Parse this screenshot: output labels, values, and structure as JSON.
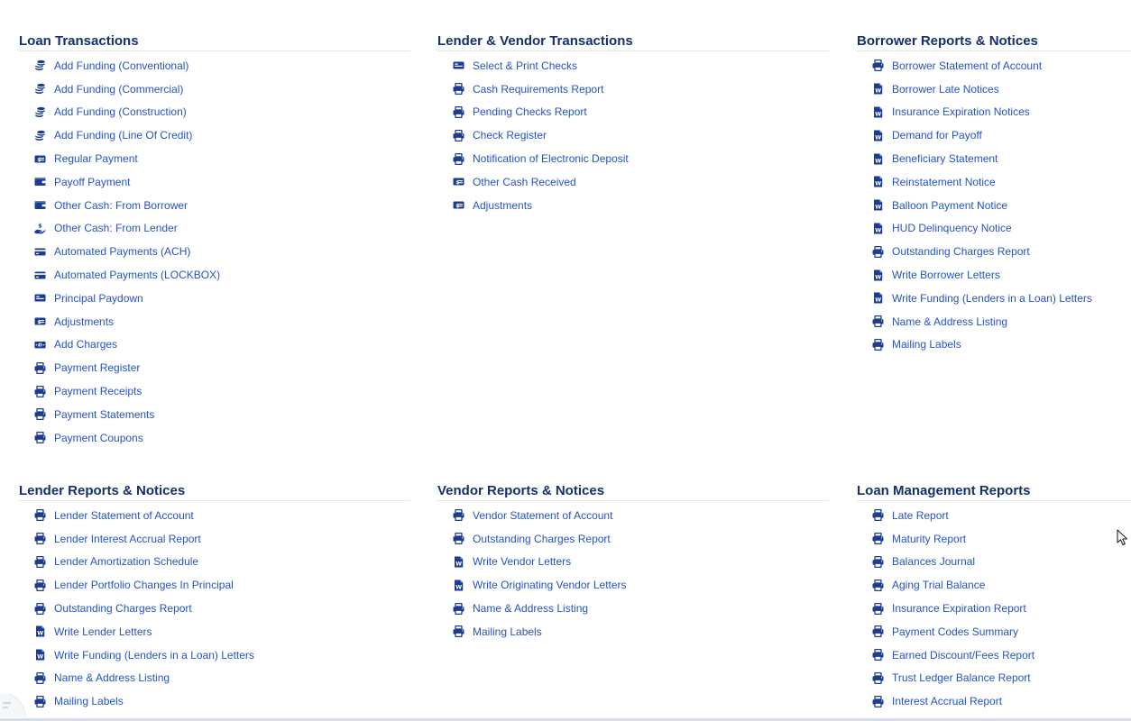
{
  "colors": {
    "heading": "#14306e",
    "link": "#2453c6",
    "icon": "#1c3c94",
    "divider": "#e2e5ea"
  },
  "sections": [
    {
      "title": "Loan Transactions",
      "items": [
        {
          "label": "Add Funding (Conventional)",
          "icon": "coins-icon"
        },
        {
          "label": "Add Funding (Commercial)",
          "icon": "coins-icon"
        },
        {
          "label": "Add Funding (Construction)",
          "icon": "coins-icon"
        },
        {
          "label": "Add Funding (Line Of Credit)",
          "icon": "coins-icon"
        },
        {
          "label": "Regular Payment",
          "icon": "money-card-icon"
        },
        {
          "label": "Payoff Payment",
          "icon": "wallet-icon"
        },
        {
          "label": "Other Cash: From Borrower",
          "icon": "wallet-icon"
        },
        {
          "label": "Other Cash: From Lender",
          "icon": "hand-dollar-icon"
        },
        {
          "label": "Automated Payments (ACH)",
          "icon": "credit-card-icon"
        },
        {
          "label": "Automated Payments (LOCKBOX)",
          "icon": "credit-card-icon"
        },
        {
          "label": "Principal Paydown",
          "icon": "id-card-icon"
        },
        {
          "label": "Adjustments",
          "icon": "money-card-icon"
        },
        {
          "label": "Add Charges",
          "icon": "money-bill-icon"
        },
        {
          "label": "Payment Register",
          "icon": "printer-icon"
        },
        {
          "label": "Payment Receipts",
          "icon": "printer-icon"
        },
        {
          "label": "Payment Statements",
          "icon": "printer-icon"
        },
        {
          "label": "Payment Coupons",
          "icon": "printer-icon"
        }
      ]
    },
    {
      "title": "Lender & Vendor Transactions",
      "items": [
        {
          "label": "Select & Print Checks",
          "icon": "id-card-icon"
        },
        {
          "label": "Cash Requirements Report",
          "icon": "printer-icon"
        },
        {
          "label": "Pending Checks Report",
          "icon": "printer-icon"
        },
        {
          "label": "Check Register",
          "icon": "printer-icon"
        },
        {
          "label": "Notification of Electronic Deposit",
          "icon": "printer-icon"
        },
        {
          "label": "Other Cash Received",
          "icon": "money-card-icon"
        },
        {
          "label": "Adjustments",
          "icon": "money-card-icon"
        }
      ]
    },
    {
      "title": "Borrower Reports & Notices",
      "items": [
        {
          "label": "Borrower Statement of Account",
          "icon": "printer-icon"
        },
        {
          "label": "Borrower Late Notices",
          "icon": "word-document-icon"
        },
        {
          "label": "Insurance Expiration Notices",
          "icon": "word-document-icon"
        },
        {
          "label": "Demand for Payoff",
          "icon": "word-document-icon"
        },
        {
          "label": "Beneficiary Statement",
          "icon": "word-document-icon"
        },
        {
          "label": "Reinstatement Notice",
          "icon": "word-document-icon"
        },
        {
          "label": "Balloon Payment Notice",
          "icon": "word-document-icon"
        },
        {
          "label": "HUD Delinquency Notice",
          "icon": "word-document-icon"
        },
        {
          "label": "Outstanding Charges Report",
          "icon": "printer-icon"
        },
        {
          "label": "Write Borrower Letters",
          "icon": "word-document-icon"
        },
        {
          "label": "Write Funding (Lenders in a Loan) Letters",
          "icon": "word-document-icon"
        },
        {
          "label": "Name & Address Listing",
          "icon": "printer-icon"
        },
        {
          "label": "Mailing Labels",
          "icon": "printer-icon"
        }
      ]
    },
    {
      "title": "Lender Reports & Notices",
      "items": [
        {
          "label": "Lender Statement of Account",
          "icon": "printer-icon"
        },
        {
          "label": "Lender Interest Accrual Report",
          "icon": "printer-icon"
        },
        {
          "label": "Lender Amortization Schedule",
          "icon": "printer-icon"
        },
        {
          "label": "Lender Portfolio Changes In Principal",
          "icon": "printer-icon"
        },
        {
          "label": "Outstanding Charges Report",
          "icon": "printer-icon"
        },
        {
          "label": "Write Lender Letters",
          "icon": "word-document-icon"
        },
        {
          "label": "Write Funding (Lenders in a Loan) Letters",
          "icon": "word-document-icon"
        },
        {
          "label": "Name & Address Listing",
          "icon": "printer-icon"
        },
        {
          "label": "Mailing Labels",
          "icon": "printer-icon"
        }
      ]
    },
    {
      "title": "Vendor Reports & Notices",
      "items": [
        {
          "label": "Vendor Statement of Account",
          "icon": "printer-icon"
        },
        {
          "label": "Outstanding Charges Report",
          "icon": "printer-icon"
        },
        {
          "label": "Write Vendor Letters",
          "icon": "word-document-icon"
        },
        {
          "label": "Write Originating Vendor Letters",
          "icon": "word-document-icon"
        },
        {
          "label": "Name & Address Listing",
          "icon": "printer-icon"
        },
        {
          "label": "Mailing Labels",
          "icon": "printer-icon"
        }
      ]
    },
    {
      "title": "Loan Management Reports",
      "items": [
        {
          "label": "Late Report",
          "icon": "printer-icon"
        },
        {
          "label": "Maturity Report",
          "icon": "printer-icon"
        },
        {
          "label": "Balances Journal",
          "icon": "printer-icon"
        },
        {
          "label": "Aging Trial Balance",
          "icon": "printer-icon"
        },
        {
          "label": "Insurance Expiration Report",
          "icon": "printer-icon"
        },
        {
          "label": "Payment Codes Summary",
          "icon": "printer-icon"
        },
        {
          "label": "Earned Discount/Fees Report",
          "icon": "printer-icon"
        },
        {
          "label": "Trust Ledger Balance Report",
          "icon": "printer-icon"
        },
        {
          "label": "Interest Accrual Report",
          "icon": "printer-icon"
        }
      ]
    }
  ]
}
